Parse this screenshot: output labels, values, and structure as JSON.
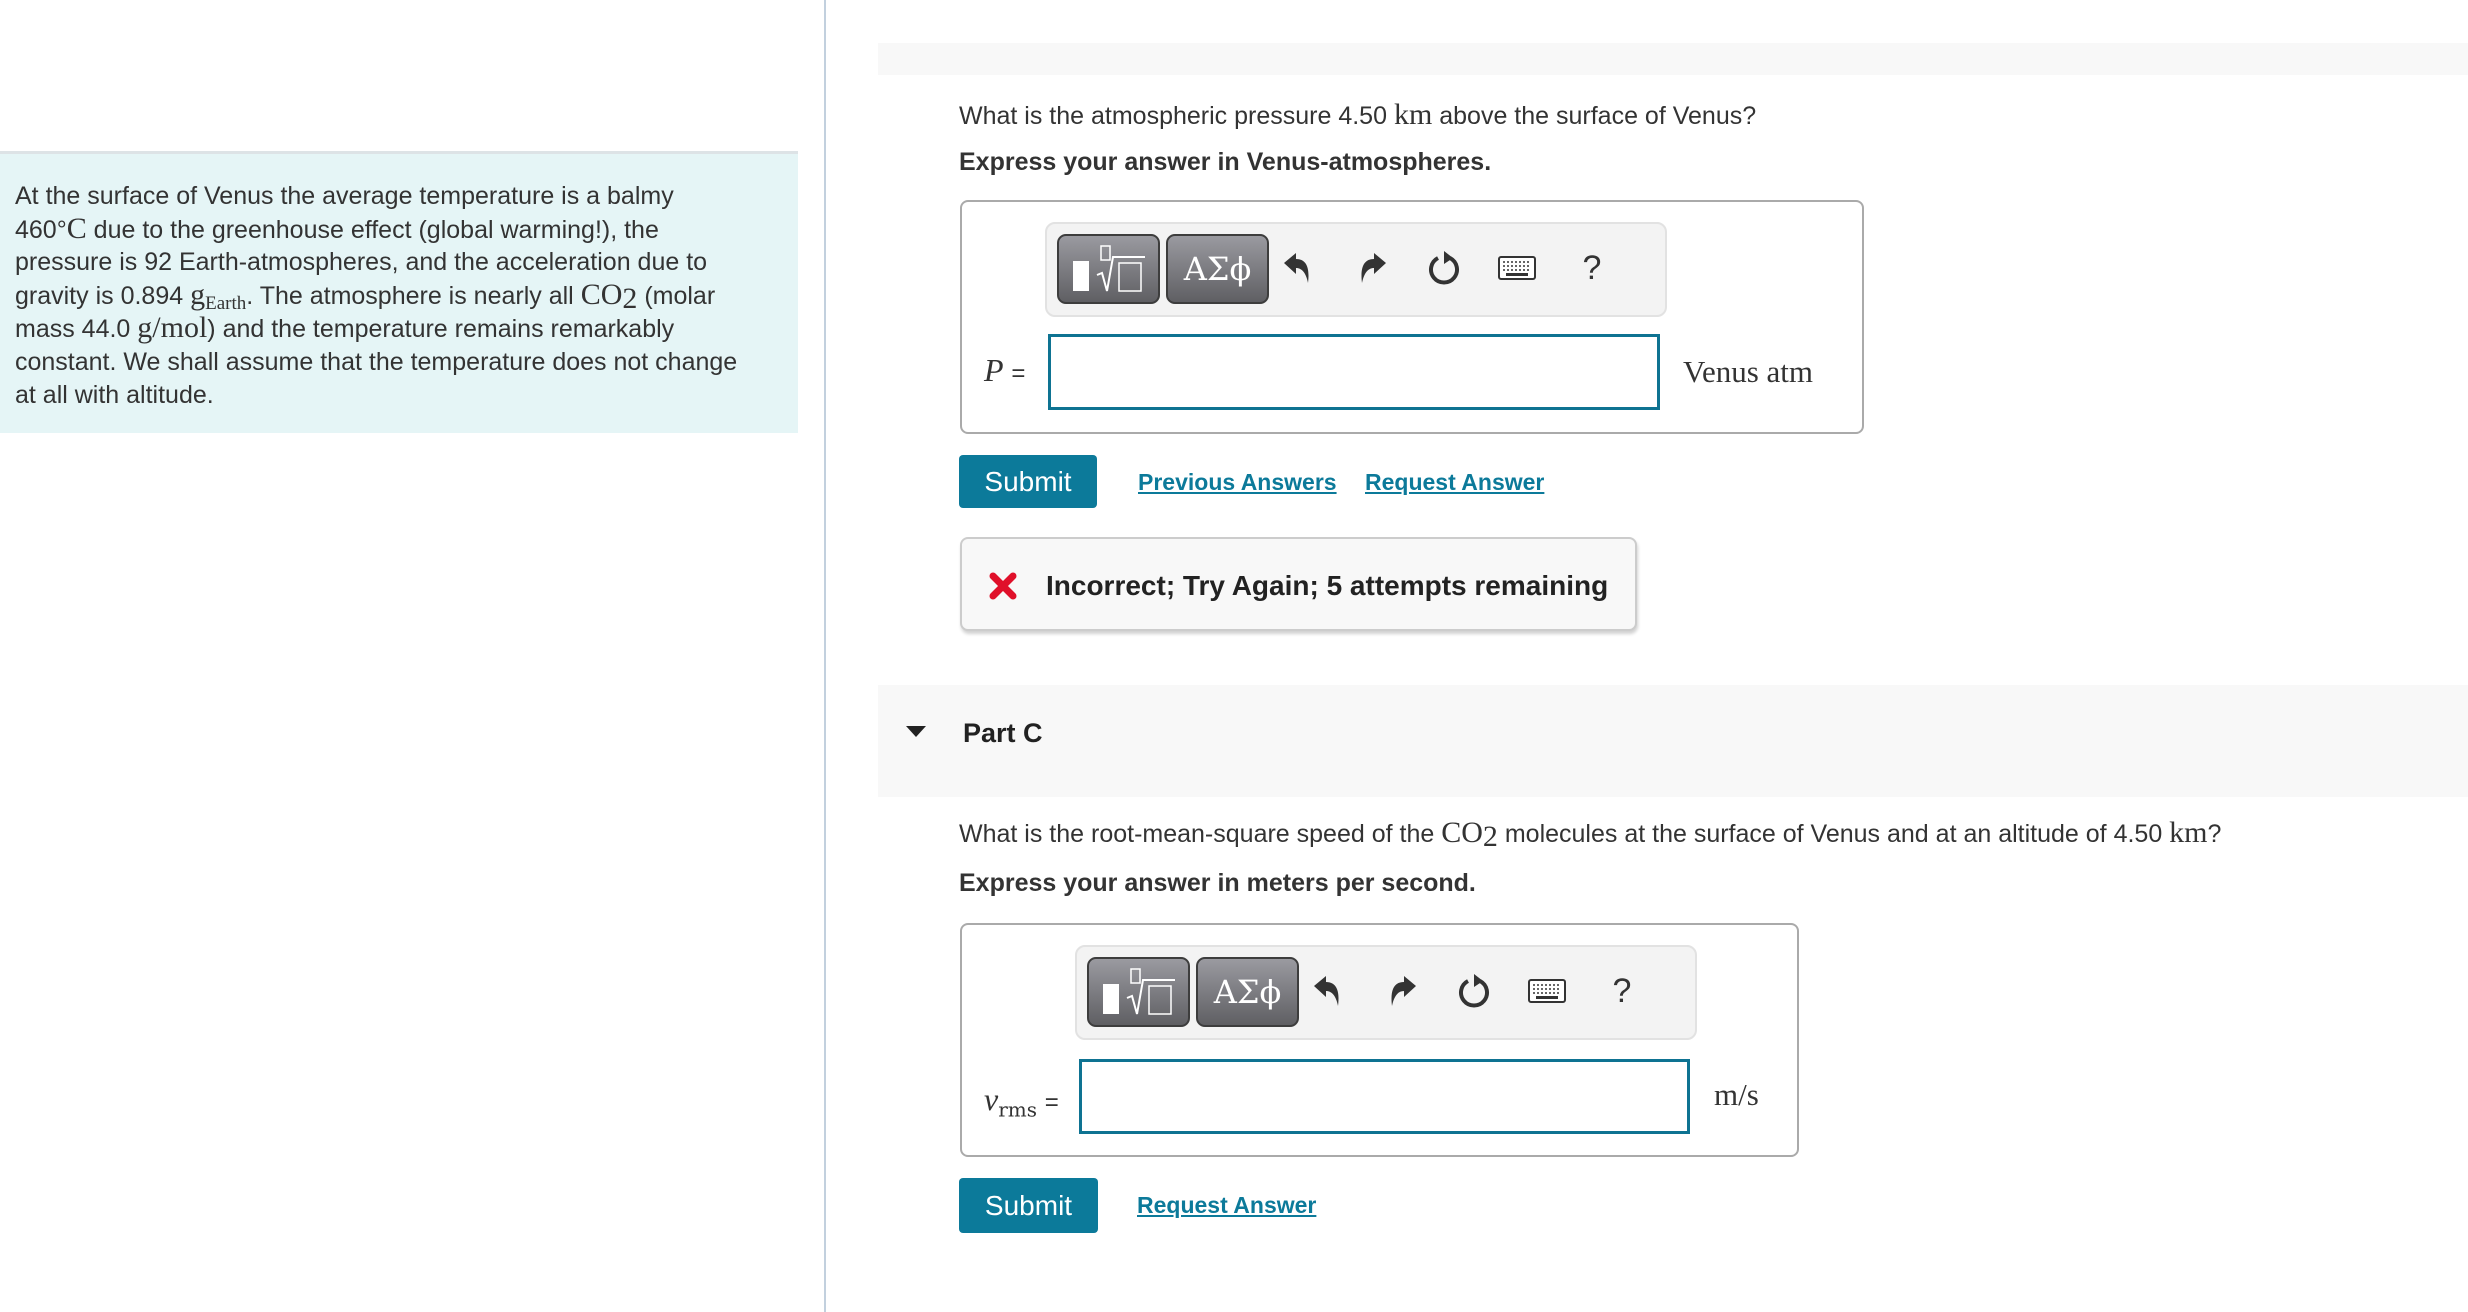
{
  "intro": {
    "line1": "At the surface of Venus the average temperature is a balmy",
    "line2_num": "460",
    "line2_deg": "°",
    "line2_unit": "C",
    "line2_rest": " due to the greenhouse effect (global warming!), the",
    "line3": "pressure is 92 Earth-atmospheres, and the acceleration due to",
    "line4_pre": "gravity is 0.894 ",
    "line4_g": "g",
    "line4_sub": "Earth",
    "line4_mid": ". The atmosphere is nearly all ",
    "line4_co": "CO",
    "line4_co_sub": "2",
    "line4_post": " (molar",
    "line5_pre": "mass 44.0 ",
    "line5_unit": "g/mol",
    "line5_post": ") and the temperature remains remarkably",
    "line6": "constant. We shall assume that the temperature does not change",
    "line7": "at all with altitude."
  },
  "partB": {
    "question_pre": "What is the atmospheric pressure 4.50 ",
    "question_unit": "km",
    "question_post": " above the surface of Venus?",
    "instruction": "Express your answer in Venus-atmospheres.",
    "variable": "P",
    "equals": "=",
    "input_value": "",
    "unit": "Venus atm",
    "submit_label": "Submit",
    "previous_answers_label": "Previous Answers",
    "request_answer_label": "Request Answer",
    "feedback": {
      "status": "incorrect",
      "icon": "x-mark-icon",
      "message": "Incorrect; Try Again; 5 attempts remaining",
      "color": "#e0102a"
    }
  },
  "toolbar": {
    "templates_icon": "templates-sqrt-icon",
    "symbols_label": "ΑΣϕ",
    "undo_icon": "undo-icon",
    "redo_icon": "redo-icon",
    "reset_icon": "reset-icon",
    "keyboard_icon": "keyboard-icon",
    "help_label": "?"
  },
  "partC": {
    "title": "Part C",
    "expanded": true,
    "question_pre": "What is the root-mean-square speed of the ",
    "question_co": "CO",
    "question_co_sub": "2",
    "question_mid": " molecules at the surface of Venus and at an altitude of 4.50 ",
    "question_unit": "km",
    "question_post": "?",
    "instruction": "Express your answer in meters per second.",
    "variable": "v",
    "variable_sub": "rms",
    "equals": "=",
    "input_value": "",
    "unit": "m/s",
    "submit_label": "Submit",
    "request_answer_label": "Request Answer"
  },
  "colors": {
    "accent": "#0c7a9a",
    "intro_bg": "#e5f5f6",
    "band_bg": "#f8f8f8",
    "error": "#e0102a"
  }
}
